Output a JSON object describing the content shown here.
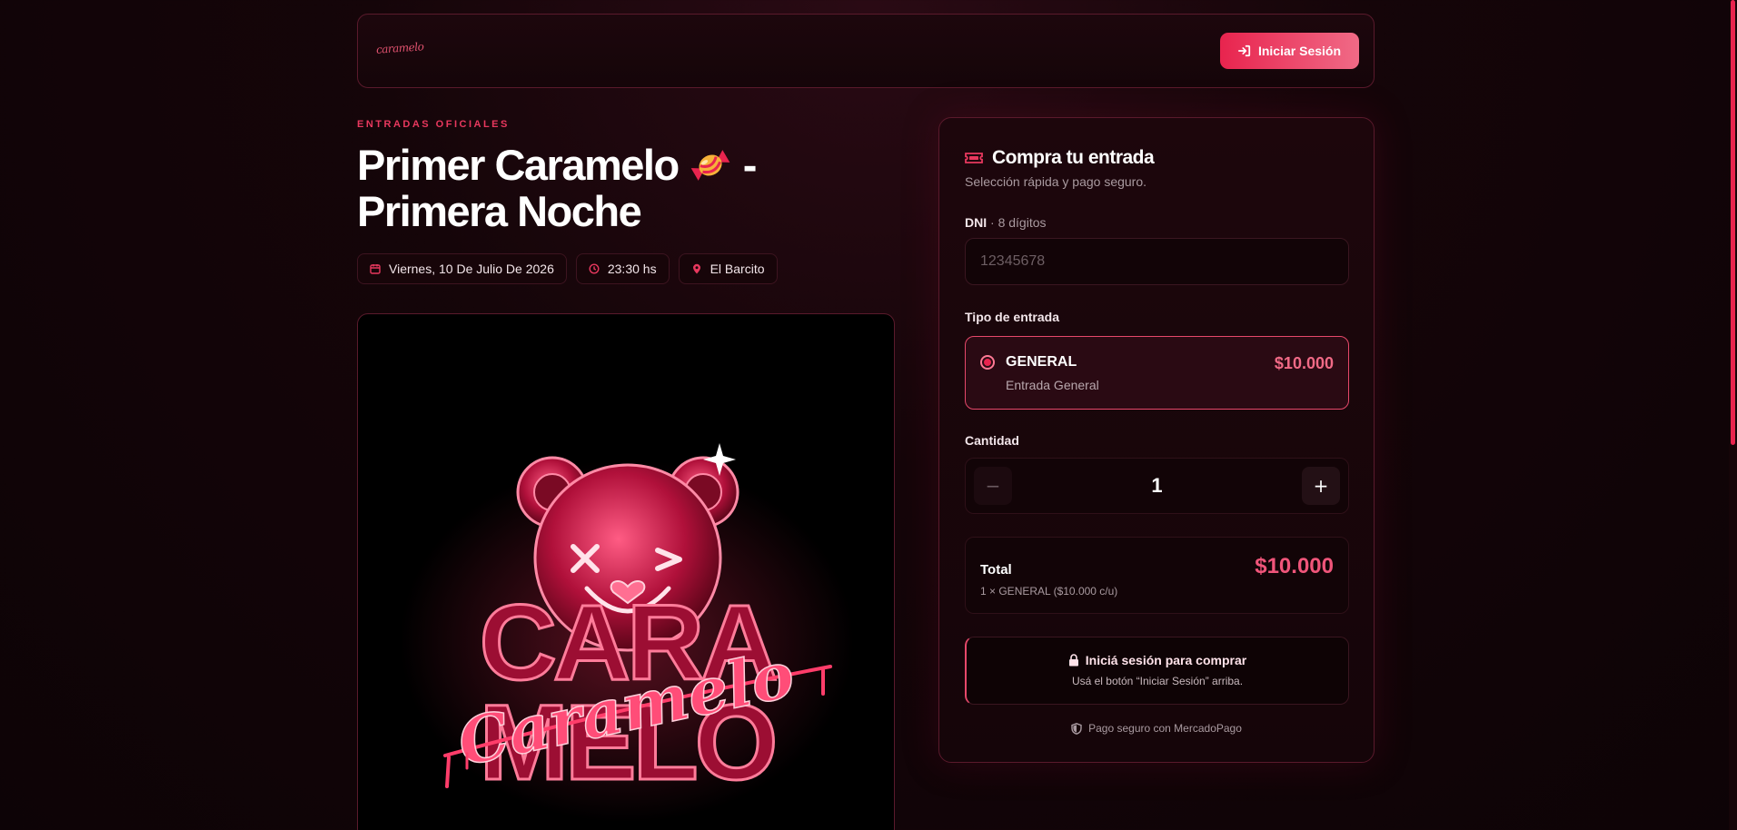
{
  "header": {
    "logo_text": "caramelo",
    "login_label": "Iniciar Sesión"
  },
  "event": {
    "eyebrow": "ENTRADAS OFICIALES",
    "title_part1": "Primer Caramelo",
    "title_part2": " - Primera Noche",
    "date": "Viernes, 10 De Julio De 2026",
    "time": "23:30 hs",
    "venue": "El Barcito",
    "poster_text_top": "CARA",
    "poster_text_script": "Caramelo",
    "poster_text_bottom": "MELO"
  },
  "purchase": {
    "title": "Compra tu entrada",
    "subtitle": "Selección rápida y pago seguro.",
    "dni_label": "DNI",
    "dni_hint": " · 8 dígitos",
    "dni_value": "",
    "dni_placeholder": "12345678",
    "type_label": "Tipo de entrada",
    "ticket": {
      "name": "GENERAL",
      "description": "Entrada General",
      "price": "$10.000",
      "selected": true
    },
    "quantity_label": "Cantidad",
    "quantity_minus": "−",
    "quantity_plus": "+",
    "quantity": "1",
    "total_label": "Total",
    "total_detail": "1 × GENERAL ($10.000 c/u)",
    "total_amount": "$10.000",
    "notice_title": "Iniciá sesión para comprar",
    "notice_text": "Usá el botón “Iniciar Sesión” arriba.",
    "secure_note": "Pago seguro con MercadoPago"
  },
  "icons": {
    "login": "sign-in-icon",
    "calendar": "calendar-icon",
    "clock": "clock-icon",
    "location": "location-pin-icon",
    "ticket": "ticket-icon",
    "lock": "lock-icon",
    "shield": "shield-icon",
    "candy": "candy-icon"
  },
  "colors": {
    "accent": "#e8244e",
    "accent_light": "#f06a86",
    "background": "#150509",
    "border": "#5a1a2c"
  },
  "scroll": {
    "position_fraction": 0.0
  }
}
